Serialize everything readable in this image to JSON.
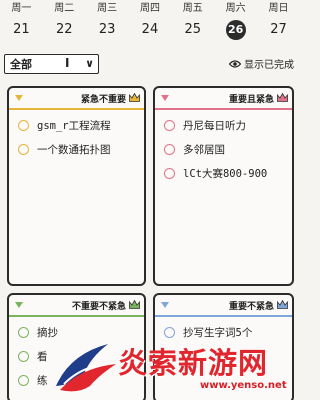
{
  "week": {
    "days": [
      {
        "name": "周一",
        "num": "21"
      },
      {
        "name": "周二",
        "num": "22"
      },
      {
        "name": "周三",
        "num": "23"
      },
      {
        "name": "周四",
        "num": "24"
      },
      {
        "name": "周五",
        "num": "25"
      },
      {
        "name": "周六",
        "num": "26"
      },
      {
        "name": "周日",
        "num": "27"
      }
    ],
    "selected_index": 5
  },
  "filter": {
    "selected": "全部",
    "caret": "I",
    "chevron_icon": "chevron-down-icon"
  },
  "show_completed": {
    "label": "显示已完成",
    "icon": "eye-icon"
  },
  "quadrants": [
    {
      "title": "紧急不重要",
      "accent": "#e6b63a",
      "tasks": [
        "gsm_r工程流程",
        "一个数通拓扑图"
      ]
    },
    {
      "title": "重要且紧急",
      "accent": "#e0738a",
      "tasks": [
        "丹尼每日听力",
        "多邻居国",
        "lCt大赛800-900"
      ]
    },
    {
      "title": "不重要不紧急",
      "accent": "#7bb45f",
      "tasks": [
        "摘抄",
        "看",
        "练"
      ]
    },
    {
      "title": "重要不紧急",
      "accent": "#7fa6d8",
      "tasks": [
        "抄写生字词5个"
      ]
    }
  ],
  "watermark": {
    "text": "炎索新游网",
    "url": "www.yenso.net",
    "color": "#e2262e"
  }
}
